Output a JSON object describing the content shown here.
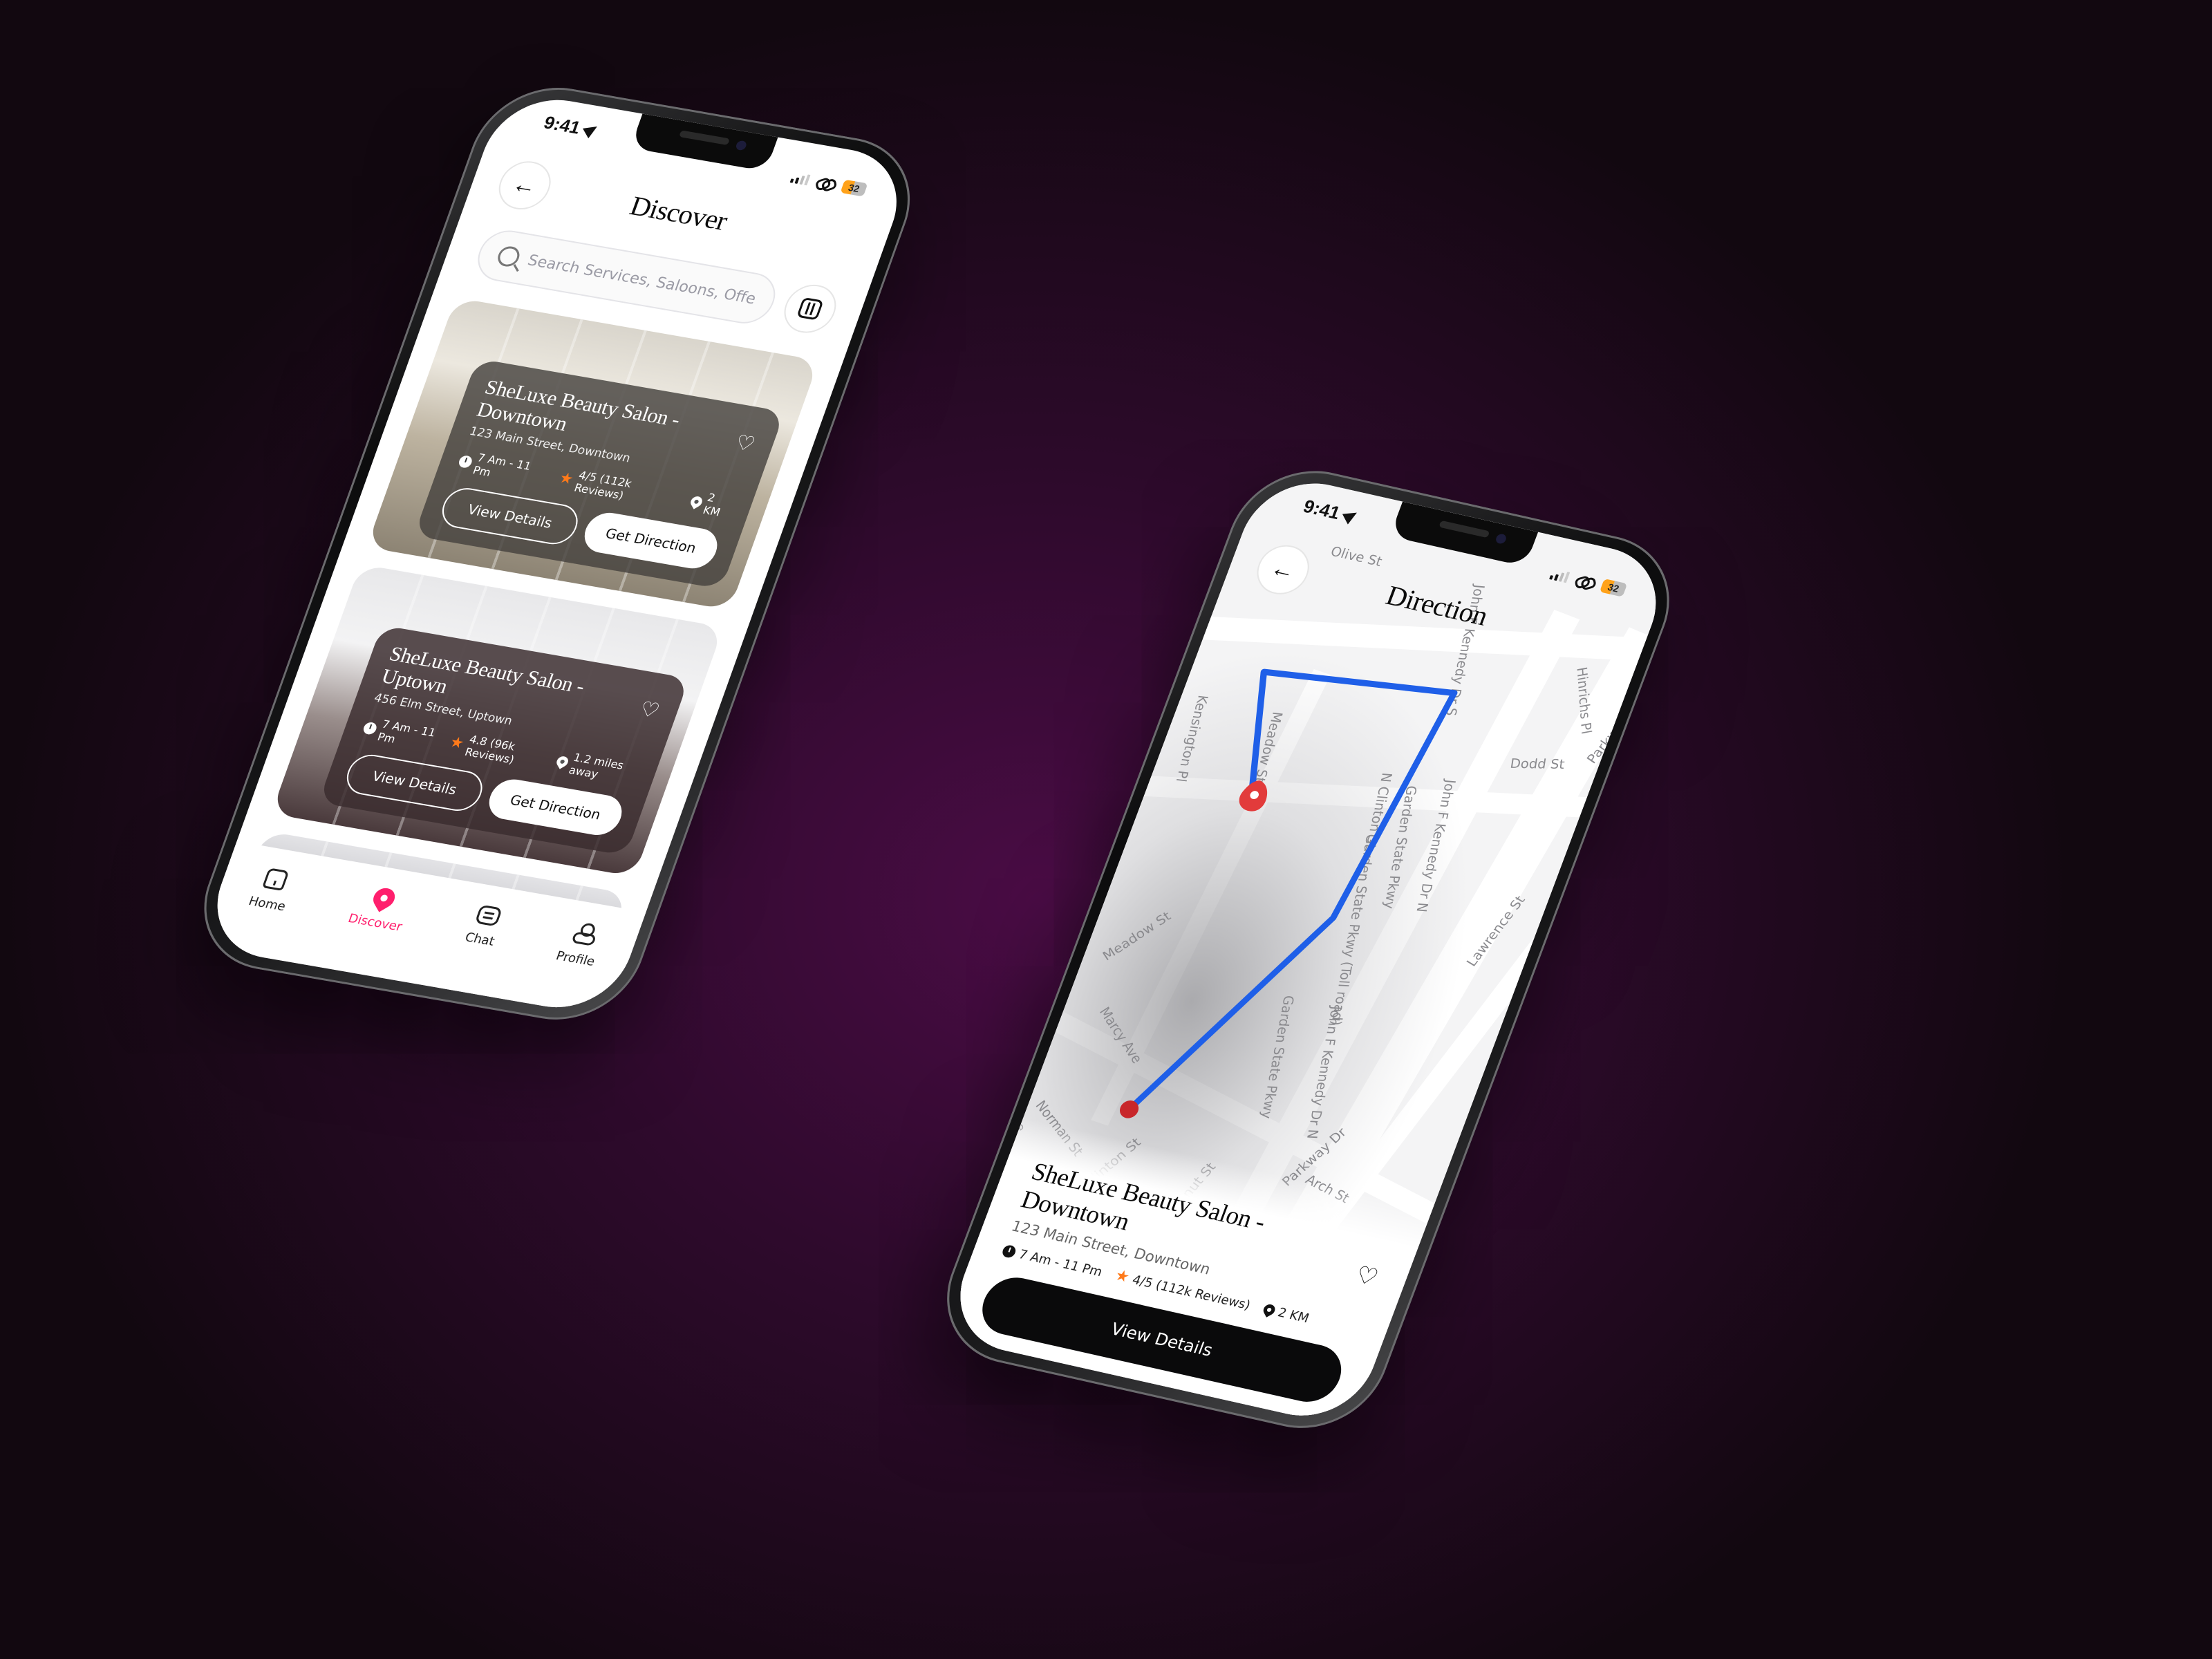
{
  "status_bar": {
    "time": "9:41",
    "battery": "32"
  },
  "discover_screen": {
    "title": "Discover",
    "search": {
      "placeholder": "Search Services, Saloons, Offers",
      "value": ""
    },
    "salons": [
      {
        "name": "SheLuxe Beauty Salon - Downtown",
        "address": "123 Main Street, Downtown",
        "hours": "7 Am - 11 Pm",
        "rating": "4/5 (112k Reviews)",
        "distance": "2 KM",
        "view_details_label": "View Details",
        "get_direction_label": "Get Direction"
      },
      {
        "name": "SheLuxe Beauty Salon - Uptown",
        "address": "456 Elm Street, Uptown",
        "hours": "7 Am - 11 Pm",
        "rating": "4.8 (96k Reviews)",
        "distance": "1.2 miles away",
        "view_details_label": "View Details",
        "get_direction_label": "Get Direction"
      }
    ],
    "tabs": [
      {
        "label": "Home",
        "icon": "home-icon",
        "active": false
      },
      {
        "label": "Discover",
        "icon": "location-pin-icon",
        "active": true
      },
      {
        "label": "Chat",
        "icon": "chat-icon",
        "active": false
      },
      {
        "label": "Profile",
        "icon": "profile-icon",
        "active": false
      }
    ]
  },
  "direction_screen": {
    "title": "Direction",
    "map": {
      "street_labels": [
        "Olive St",
        "John F Kennedy Dr S",
        "Hinrichs Pl",
        "Dodd St",
        "Parkway Dr",
        "Kensington Pl",
        "Meadow St",
        "N Clinton St",
        "Garden State Pkwy",
        "Garden State Pkwy (Toll road)",
        "John F Kennedy Dr N",
        "Lawrence St",
        "Meadow St",
        "Marcy Ave",
        "Garden State Pkwy",
        "John F Kennedy Dr N",
        "Parkway Dr",
        "Arch St",
        "Norman St",
        "N Clinton St",
        "N Walnut St",
        "Ave",
        "Pkwy"
      ],
      "route_color": "#1f5fe8",
      "origin_color": "#c8262a",
      "destination_color": "#e23b3b"
    },
    "salon": {
      "name": "SheLuxe Beauty Salon - Downtown",
      "address": "123 Main Street, Downtown",
      "hours": "7 Am - 11 Pm",
      "rating": "4/5 (112k Reviews)",
      "distance": "2 KM",
      "view_details_label": "View Details"
    }
  },
  "colors": {
    "accent": "#ff1f6d",
    "star": "#ff7a1a",
    "battery": "#ffa21a",
    "background": "#3a0a36"
  }
}
